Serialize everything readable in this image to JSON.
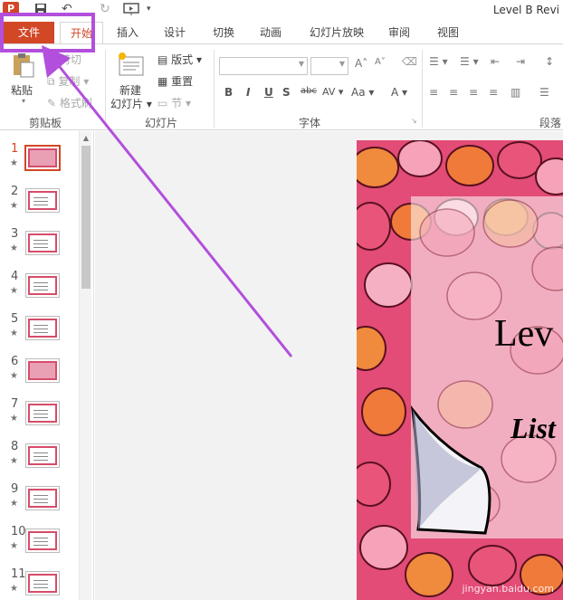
{
  "window": {
    "title": "Level B Revi"
  },
  "tabs": [
    {
      "label": "文件"
    },
    {
      "label": "开始"
    },
    {
      "label": "插入"
    },
    {
      "label": "设计"
    },
    {
      "label": "切换"
    },
    {
      "label": "动画"
    },
    {
      "label": "幻灯片放映"
    },
    {
      "label": "审阅"
    },
    {
      "label": "视图"
    }
  ],
  "ribbon": {
    "clipboard": {
      "paste": "粘贴",
      "cut": "剪切",
      "copy": "复制",
      "format_painter": "格式刷",
      "group": "剪贴板"
    },
    "slides": {
      "new_slide_line1": "新建",
      "new_slide_line2": "幻灯片",
      "layout": "版式",
      "reset": "重置",
      "section": "节",
      "group": "幻灯片"
    },
    "font": {
      "group": "字体"
    },
    "paragraph": {
      "group": "段落"
    }
  },
  "thumbnails": [
    {
      "num": "1",
      "style": "pink"
    },
    {
      "num": "2"
    },
    {
      "num": "3"
    },
    {
      "num": "4"
    },
    {
      "num": "5"
    },
    {
      "num": "6",
      "style": "pink"
    },
    {
      "num": "7"
    },
    {
      "num": "8"
    },
    {
      "num": "9"
    },
    {
      "num": "10"
    },
    {
      "num": "11"
    }
  ],
  "slide": {
    "title": "Lev",
    "subtitle": "List"
  },
  "colors": {
    "accent": "#d24726",
    "annotation": "#b24fdc",
    "slide_bg": "#e9557a"
  },
  "watermark": "jingyan.baidu.com"
}
